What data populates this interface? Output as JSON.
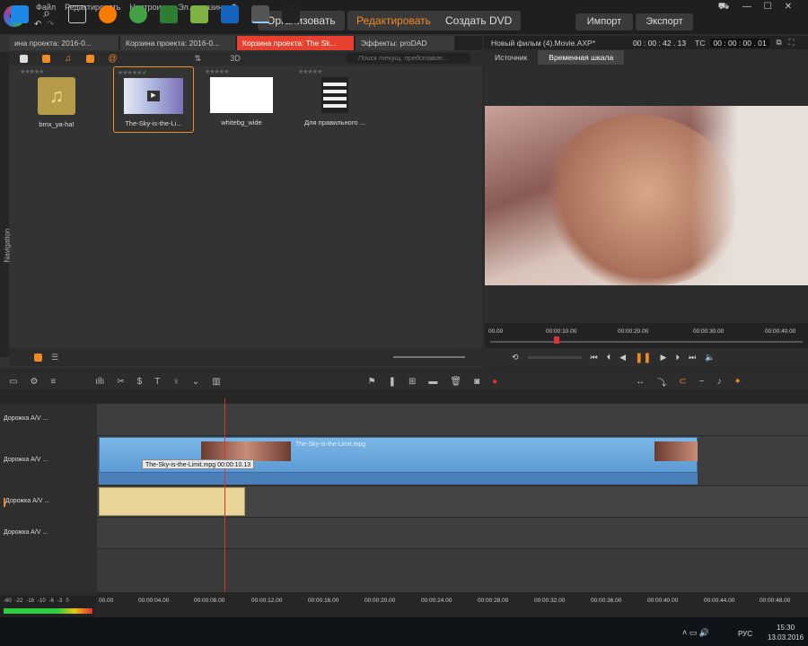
{
  "menu": [
    "Файл",
    "Редактировать",
    "Настроить",
    "Эл. магазин",
    "?"
  ],
  "modes": {
    "organize": "Организовать",
    "edit": "Редактировать",
    "dvd": "Создать DVD"
  },
  "io": {
    "import": "Импорт",
    "export": "Экспорт"
  },
  "library": {
    "tabs": [
      "ина проекта: 2016-0...",
      "Корзина проекта: 2016-0...",
      "Корзина проекта: The Sk...",
      "Эффекты: proDAD"
    ],
    "search_placeholder": "Поиск текущ. представле...",
    "nav_label": "Navigation",
    "assets": [
      {
        "label": "bmx_ya-ha!",
        "type": "audio"
      },
      {
        "label": "The-Sky-is-the-Li...",
        "type": "video"
      },
      {
        "label": "whitebg_wide",
        "type": "image"
      },
      {
        "label": "Для правильного ...",
        "type": "project"
      }
    ],
    "toolbar_3d": "3D"
  },
  "preview": {
    "title": "Новый фильм (4).Movie.AXP*",
    "timecode1": "00 : 00 : 42 . 13",
    "tc_label": "TC",
    "timecode2": "00 : 00 : 00 . 01",
    "tabs": [
      "Источник",
      "Временная шкала"
    ],
    "ruler": [
      "00.00",
      "00:00:10.00",
      "00:00:20.00",
      "00:00:30.00",
      "00:00:40.00"
    ]
  },
  "timeline": {
    "tracks": [
      "Дорожка A/V ...",
      "Дорожка A/V ...",
      "Дорожка A/V ...",
      "Дорожка A/V ..."
    ],
    "clip_name": "The-Sky-is-the-Limit.mpg",
    "tooltip": "The-Sky-is-the-Limit.mpg  00:00:10.13",
    "ruler": [
      "00.00",
      "00:00:04.00",
      "00:00:08.00",
      "00:00:12.00",
      "00:00:16.00",
      "00:00:20.00",
      "00:00:24.00",
      "00:00:28.00",
      "00:00:32.00",
      "00:00:36.00",
      "00:00:40.00",
      "00:00:44.00",
      "00:00:48.00"
    ],
    "vu_scale": [
      "-60",
      "-22",
      "-16",
      "-10",
      "-6",
      "-3",
      "0"
    ]
  },
  "taskbar": {
    "lang": "РУС",
    "time": "15:30",
    "date": "13.03.2016"
  }
}
